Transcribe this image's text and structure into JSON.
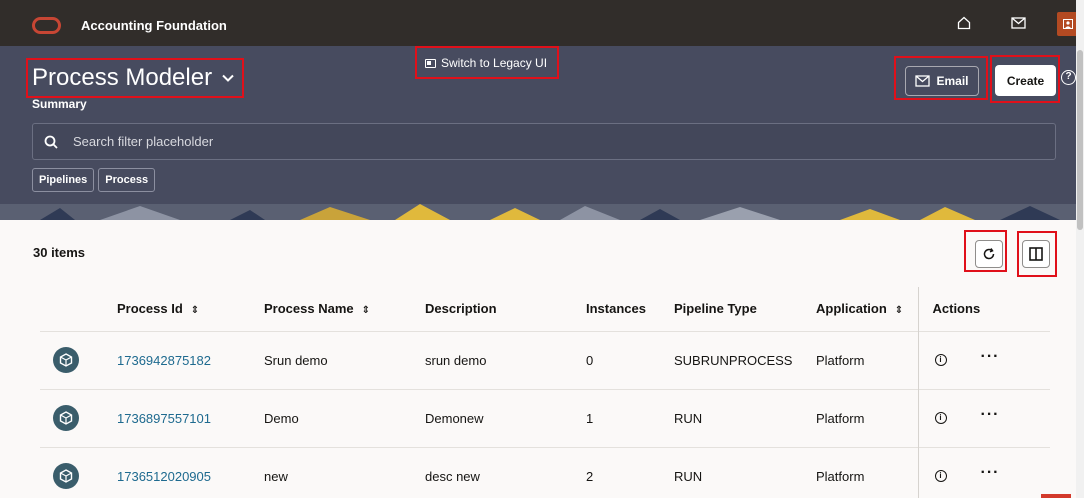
{
  "topbar": {
    "app_title": "Accounting Foundation"
  },
  "header": {
    "page_title": "Process Modeler",
    "legacy_link": "Switch to Legacy UI",
    "subtitle": "Summary",
    "email_label": "Email",
    "create_label": "Create",
    "search_placeholder": "Search filter placeholder",
    "chips": [
      "Pipelines",
      "Process"
    ]
  },
  "content": {
    "item_count": "30 items",
    "columns": {
      "process_id": "Process Id",
      "process_name": "Process Name",
      "description": "Description",
      "instances": "Instances",
      "pipeline_type": "Pipeline Type",
      "application": "Application",
      "actions": "Actions"
    },
    "rows": [
      {
        "process_id": "1736942875182",
        "process_name": "Srun demo",
        "description": "srun demo",
        "instances": "0",
        "pipeline_type": "SUBRUNPROCESS",
        "application": "Platform"
      },
      {
        "process_id": "1736897557101",
        "process_name": "Demo",
        "description": "Demonew",
        "instances": "1",
        "pipeline_type": "RUN",
        "application": "Platform"
      },
      {
        "process_id": "1736512020905",
        "process_name": "new",
        "description": "desc new",
        "instances": "2",
        "pipeline_type": "RUN",
        "application": "Platform"
      }
    ]
  },
  "colors": {
    "topbar": "#312d2a",
    "header": "#474b5f",
    "link": "#1e6a8f",
    "highlight": "#e0101a",
    "row_icon": "#3a5d6b"
  }
}
